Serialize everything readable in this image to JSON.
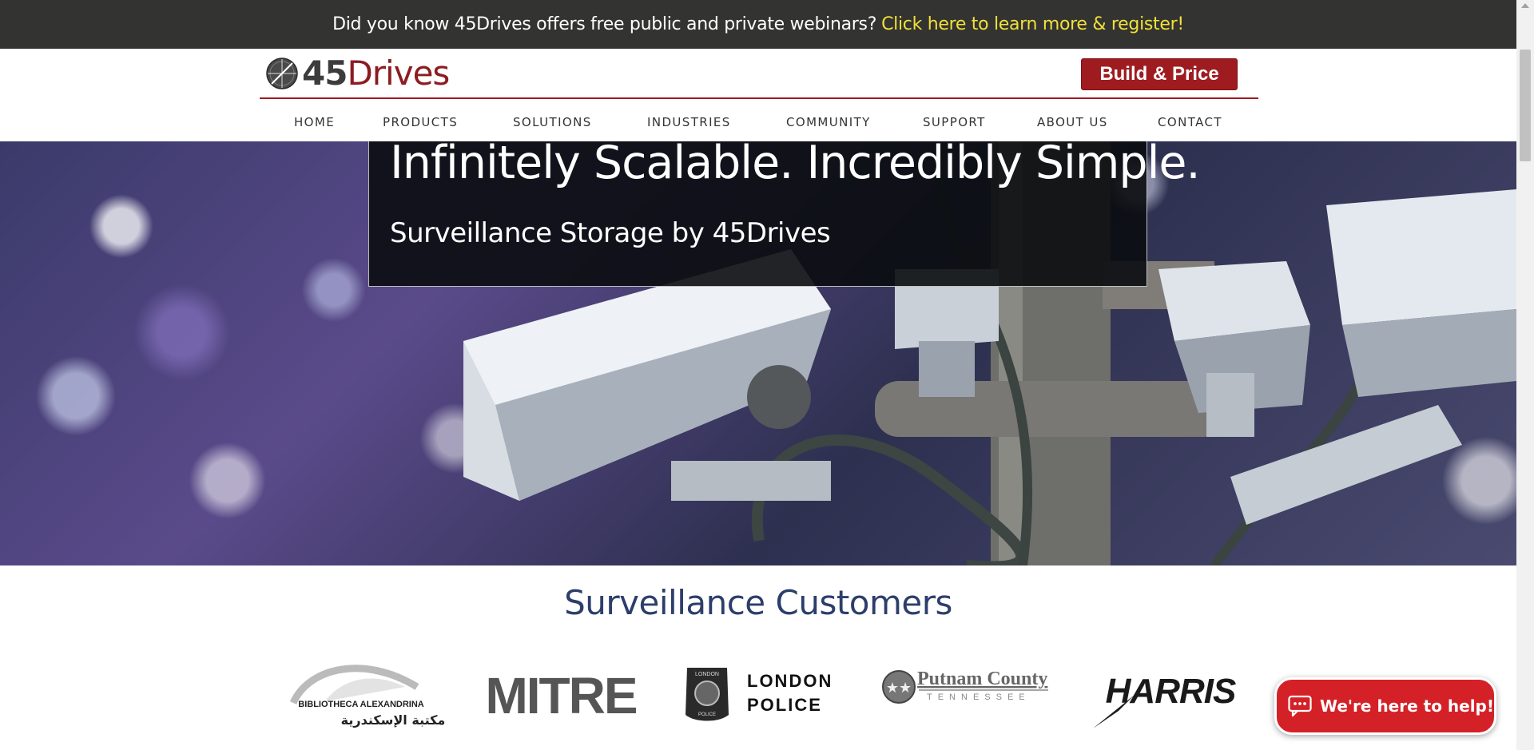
{
  "announcement": {
    "text": "Did you know 45Drives offers free public and private webinars?",
    "link": "Click here to learn more & register!"
  },
  "header": {
    "logo_number": "45",
    "logo_word": "Drives",
    "build_button": "Build & Price"
  },
  "nav": {
    "items": [
      {
        "label": "HOME"
      },
      {
        "label": "PRODUCTS"
      },
      {
        "label": "SOLUTIONS"
      },
      {
        "label": "INDUSTRIES"
      },
      {
        "label": "COMMUNITY"
      },
      {
        "label": "SUPPORT"
      },
      {
        "label": "ABOUT US"
      },
      {
        "label": "CONTACT"
      }
    ]
  },
  "hero": {
    "title": "Infinitely Scalable. Incredibly Simple.",
    "subtitle": "Surveillance Storage by 45Drives"
  },
  "customers": {
    "title": "Surveillance Customers",
    "logos": [
      {
        "name": "bibliotheca-alexandrina",
        "line1": "BIBLIOTHECA ALEXANDRINA",
        "line2": "مكتبة الإسكندرية"
      },
      {
        "name": "mitre",
        "line1": "MITRE"
      },
      {
        "name": "london-police",
        "line1": "LONDON",
        "line2": "POLICE",
        "badge_top": "LONDON",
        "badge_bottom": "POLICE"
      },
      {
        "name": "putnam-county",
        "line1": "Putnam County",
        "line2": "TENNESSEE"
      },
      {
        "name": "harris",
        "line1": "HARRIS"
      }
    ]
  },
  "chat": {
    "label": "We're here to help!"
  },
  "colors": {
    "brand_red": "#9e1b20",
    "announce_bg": "#333331",
    "announce_link": "#f0e03a",
    "customers_title": "#2c3e6a",
    "chat_red": "#d42127"
  }
}
